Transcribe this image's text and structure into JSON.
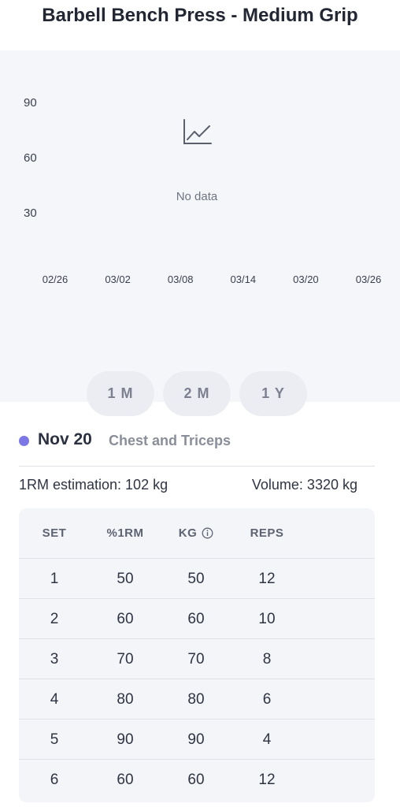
{
  "title": "Barbell Bench Press - Medium Grip",
  "chart": {
    "empty_message": "No data",
    "empty_icon": "line-chart-icon",
    "background": "#f5f6fa"
  },
  "chart_data": {
    "type": "line",
    "title": "",
    "xlabel": "",
    "ylabel": "",
    "y_ticks": [
      "90",
      "60",
      "30"
    ],
    "x_ticks": [
      "02/26",
      "03/02",
      "03/08",
      "03/14",
      "03/20",
      "03/26"
    ],
    "ylim": [
      0,
      90
    ],
    "series": []
  },
  "range_buttons": [
    {
      "label": "1 M",
      "active": true
    },
    {
      "label": "2 M",
      "active": false
    },
    {
      "label": "1 Y",
      "active": false
    }
  ],
  "session": {
    "date": "Nov 20",
    "name": "Chest and Triceps",
    "dot_color": "#7b78e6",
    "one_rm": "1RM estimation: 102 kg",
    "volume": "Volume: 3320 kg"
  },
  "table": {
    "headers": [
      "SET",
      "%1RM",
      "KG",
      "REPS"
    ],
    "kg_info_icon": "info-icon",
    "rows": [
      [
        "1",
        "50",
        "50",
        "12"
      ],
      [
        "2",
        "60",
        "60",
        "10"
      ],
      [
        "3",
        "70",
        "70",
        "8"
      ],
      [
        "4",
        "80",
        "80",
        "6"
      ],
      [
        "5",
        "90",
        "90",
        "4"
      ],
      [
        "6",
        "60",
        "60",
        "12"
      ]
    ]
  },
  "colors": {
    "accent": "#8e9dd0",
    "inactive_button": "#ecedf2"
  }
}
